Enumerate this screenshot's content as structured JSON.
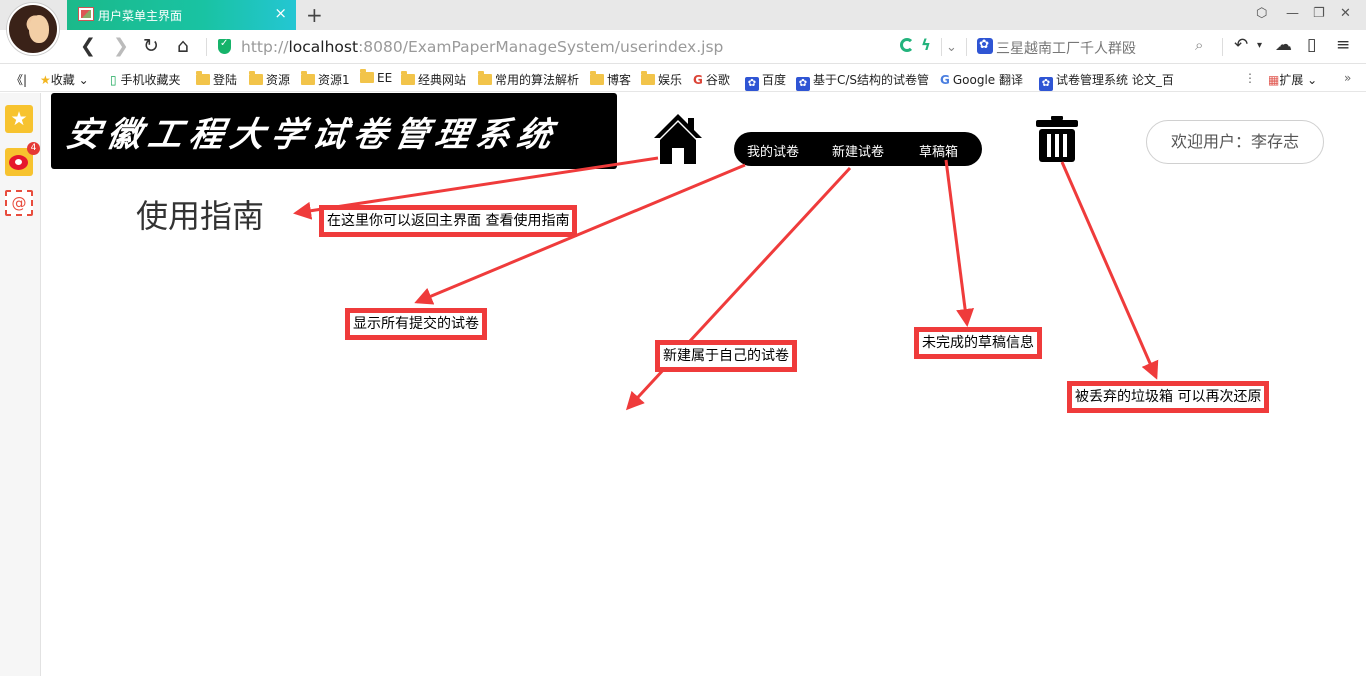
{
  "browser": {
    "tab_title": "用户菜单主界面",
    "tab_close": "×",
    "new_tab": "+",
    "url_prefix": "http://",
    "url_host": "localhost",
    "url_rest": ":8080/ExamPaperManageSystem/userindex.jsp",
    "search_placeholder": "三星越南工厂千人群殴",
    "icons": [
      "back-icon",
      "forward-icon",
      "refresh-icon",
      "home-icon",
      "security-shield-icon",
      "search-icon",
      "undo-icon",
      "cloud-icon",
      "phone-icon",
      "menu-icon"
    ]
  },
  "bookmarks": {
    "toggle": "《|",
    "items": [
      "收藏",
      "手机收藏夹",
      "登陆",
      "资源",
      "资源1",
      "EE",
      "经典网站",
      "常用的算法解析",
      "博客",
      "娱乐",
      "谷歌",
      "百度",
      "基于C/S结构的试卷管",
      "Google 翻译",
      "试卷管理系统 论文_百"
    ],
    "more": "⋮",
    "extensions": "扩展",
    "overflow": "»"
  },
  "sidebar": {
    "badge_count": "4",
    "mail_glyph": "@"
  },
  "page": {
    "logo_text": "安徽工程大学试卷管理系统",
    "menu": [
      "我的试卷",
      "新建试卷",
      "草稿箱"
    ],
    "welcome": "欢迎用户：李存志",
    "guide_title": "使用指南"
  },
  "annotations": {
    "home_note": "在这里你可以返回主界面 查看使用指南",
    "mypapers_note": "显示所有提交的试卷",
    "newpaper_note": "新建属于自己的试卷",
    "drafts_note": "未完成的草稿信息",
    "trash_note": "被丢弃的垃圾箱  可以再次还原"
  },
  "colors": {
    "tab_gradient_start": "#1bb98a",
    "tab_gradient_end": "#24c6d3",
    "annotation_red": "#ef3b3b",
    "menu_bg": "#000000"
  }
}
